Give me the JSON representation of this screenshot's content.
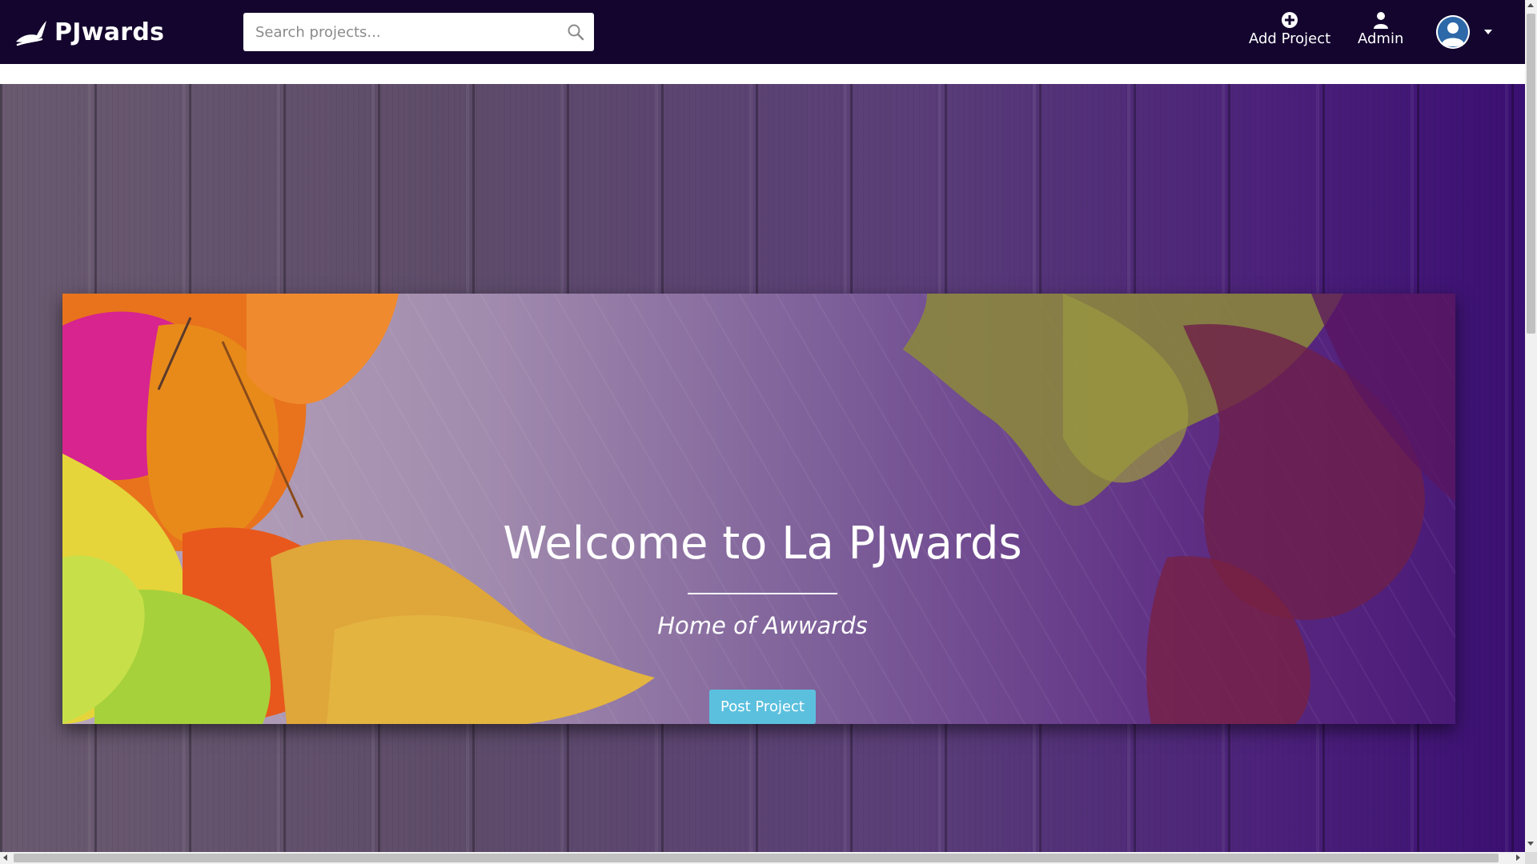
{
  "navbar": {
    "brand": {
      "name": "PJwards",
      "icon": "bird-logo-icon"
    },
    "search": {
      "placeholder": "Search projects...",
      "value": "",
      "icon": "search-icon"
    },
    "items": [
      {
        "label": "Add Project",
        "icon": "plus-circle-icon"
      },
      {
        "label": "Admin",
        "icon": "user-icon"
      }
    ],
    "avatar": {
      "icon": "user-avatar-icon"
    },
    "dropdown": {
      "icon": "caret-down-icon"
    },
    "background_color": "#13052e"
  },
  "hero": {
    "title": "Welcome to La PJwards",
    "subtitle": "Home of Awwards",
    "cta_label": "Post Project",
    "cta_color": "#5bc0de"
  }
}
